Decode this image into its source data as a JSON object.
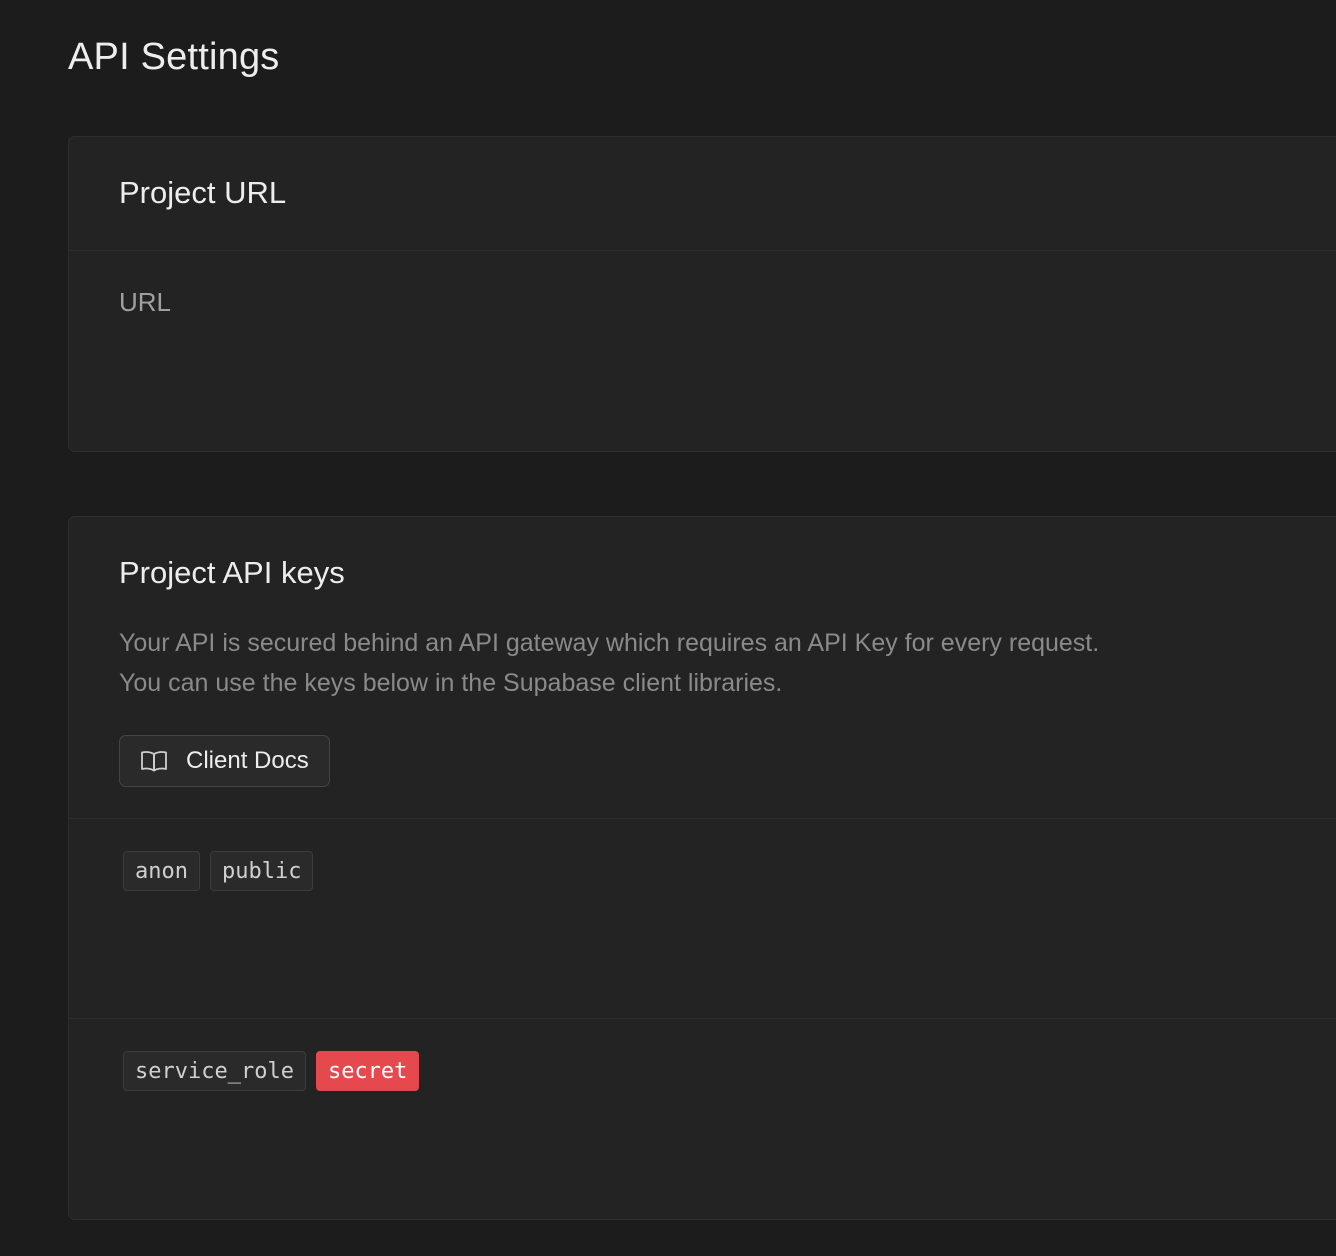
{
  "page": {
    "title": "API Settings"
  },
  "project_url": {
    "title": "Project URL",
    "url_label": "URL"
  },
  "api_keys": {
    "title": "Project API keys",
    "description_line1": "Your API is secured behind an API gateway which requires an API Key for every request.",
    "description_line2": "You can use the keys below in the Supabase client libraries.",
    "docs_button": {
      "label": "Client Docs",
      "icon": "book-open-icon"
    },
    "keys": [
      {
        "name": "anon",
        "badge": "public"
      },
      {
        "name": "service_role",
        "badge": "secret"
      }
    ]
  },
  "colors": {
    "background": "#1c1c1c",
    "panel": "#232323",
    "secret_badge": "#e5484d"
  }
}
